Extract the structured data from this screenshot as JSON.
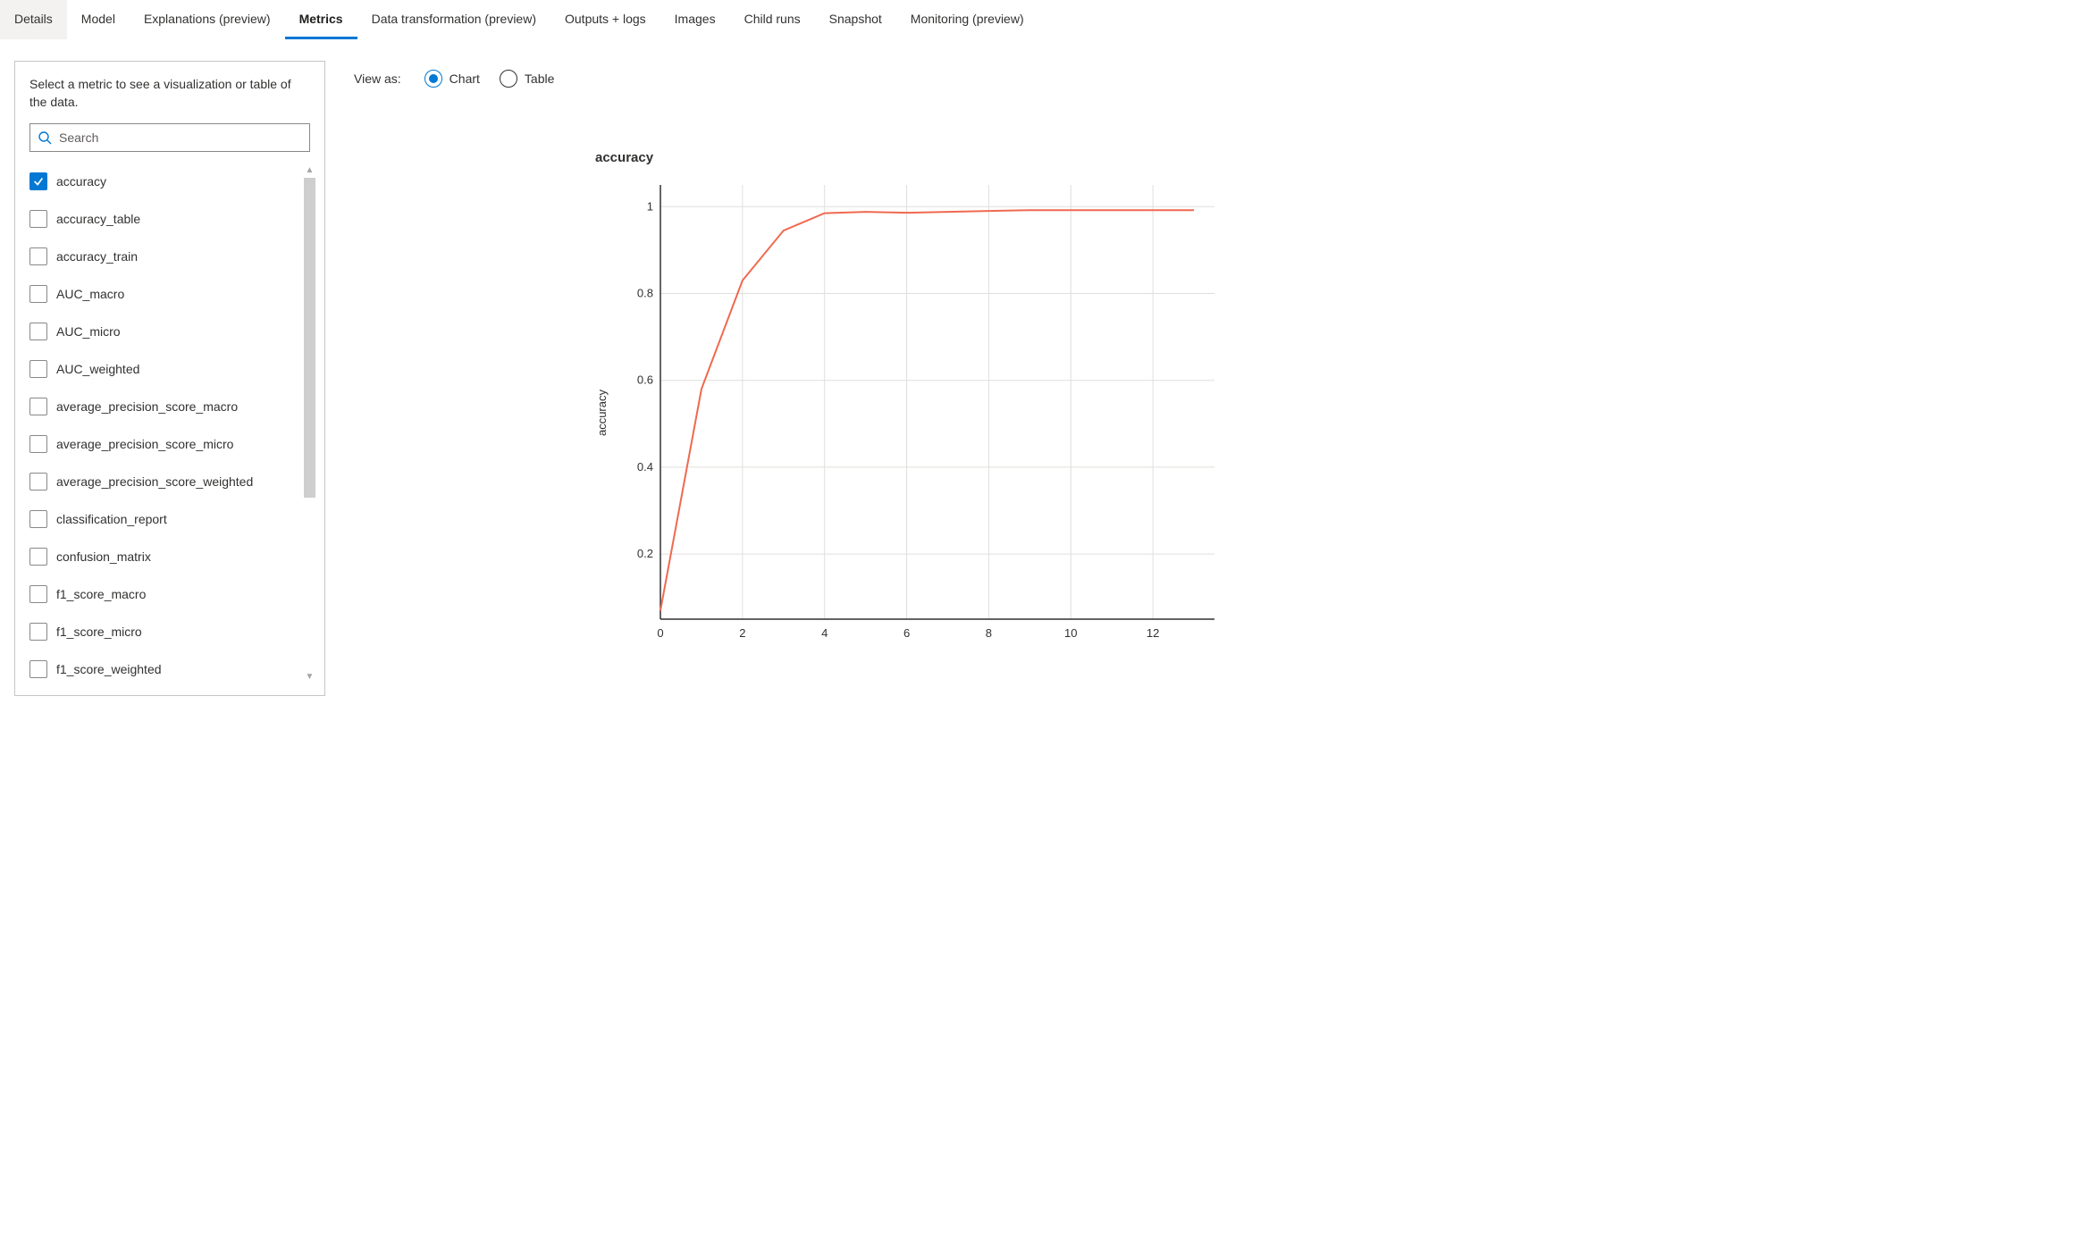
{
  "tabs": [
    {
      "label": "Details",
      "state": "active-background"
    },
    {
      "label": "Model",
      "state": "normal"
    },
    {
      "label": "Explanations (preview)",
      "state": "normal"
    },
    {
      "label": "Metrics",
      "state": "current"
    },
    {
      "label": "Data transformation (preview)",
      "state": "normal"
    },
    {
      "label": "Outputs + logs",
      "state": "normal"
    },
    {
      "label": "Images",
      "state": "normal"
    },
    {
      "label": "Child runs",
      "state": "normal"
    },
    {
      "label": "Snapshot",
      "state": "normal"
    },
    {
      "label": "Monitoring (preview)",
      "state": "normal"
    }
  ],
  "sidebar": {
    "description": "Select a metric to see a visualization or table of the data.",
    "search_placeholder": "Search",
    "metrics": [
      {
        "label": "accuracy",
        "checked": true
      },
      {
        "label": "accuracy_table",
        "checked": false
      },
      {
        "label": "accuracy_train",
        "checked": false
      },
      {
        "label": "AUC_macro",
        "checked": false
      },
      {
        "label": "AUC_micro",
        "checked": false
      },
      {
        "label": "AUC_weighted",
        "checked": false
      },
      {
        "label": "average_precision_score_macro",
        "checked": false
      },
      {
        "label": "average_precision_score_micro",
        "checked": false
      },
      {
        "label": "average_precision_score_weighted",
        "checked": false
      },
      {
        "label": "classification_report",
        "checked": false
      },
      {
        "label": "confusion_matrix",
        "checked": false
      },
      {
        "label": "f1_score_macro",
        "checked": false
      },
      {
        "label": "f1_score_micro",
        "checked": false
      },
      {
        "label": "f1_score_weighted",
        "checked": false
      }
    ]
  },
  "view_as": {
    "label": "View as:",
    "options": [
      {
        "label": "Chart",
        "selected": true
      },
      {
        "label": "Table",
        "selected": false
      }
    ]
  },
  "chart_data": {
    "type": "line",
    "title": "accuracy",
    "ylabel": "accuracy",
    "xlabel": "",
    "x": [
      0,
      1,
      2,
      3,
      4,
      5,
      6,
      7,
      8,
      9,
      10,
      11,
      12,
      13
    ],
    "values": [
      0.07,
      0.58,
      0.83,
      0.945,
      0.985,
      0.988,
      0.986,
      0.988,
      0.99,
      0.992,
      0.992,
      0.992,
      0.992,
      0.992
    ],
    "x_ticks": [
      0,
      2,
      4,
      6,
      8,
      10,
      12
    ],
    "y_ticks": [
      0.2,
      0.4,
      0.6,
      0.8,
      1
    ],
    "xlim": [
      0,
      13.5
    ],
    "ylim": [
      0.05,
      1.05
    ],
    "line_color": "#ef6950"
  }
}
